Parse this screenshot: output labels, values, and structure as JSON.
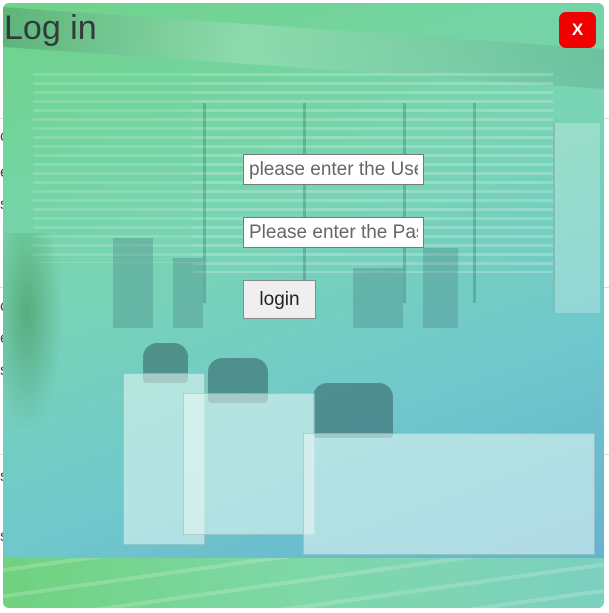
{
  "modal": {
    "title": "Log in",
    "close_label": "X",
    "username": {
      "value": "",
      "placeholder": "please enter the Username"
    },
    "password": {
      "value": "",
      "placeholder": "Please enter the Password"
    },
    "login_label": "login"
  },
  "background_page": {
    "peek_glyphs": [
      "c",
      "e",
      "s",
      "c",
      "e",
      "s",
      "s",
      "s"
    ]
  },
  "colors": {
    "close_button": "#f10000",
    "modal_gradient_start": "#6fd388",
    "modal_gradient_end": "#66b3cf",
    "title_text": "#333a3a"
  },
  "icons": {
    "close": "close-icon"
  }
}
